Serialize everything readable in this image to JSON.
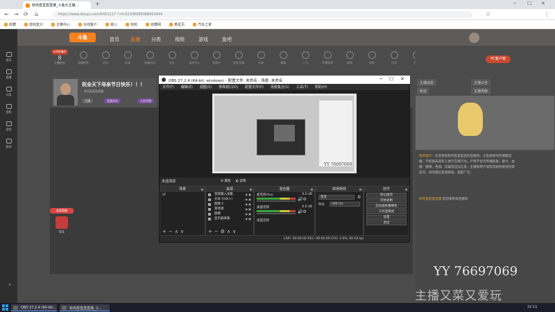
{
  "browser": {
    "tab_title": "秋丙直直直直播_斗鱼大主播...",
    "url": "https://www.douyu.com/6451217 ?=0.62206985988001644",
    "bookmarks": [
      "收藏",
      "游戏盒计",
      "主推中心",
      "在线客户",
      "婴儿",
      "哈哈",
      "收藏网",
      "黄星页",
      "汽车之家"
    ]
  },
  "site": {
    "logo": "斗鱼",
    "nav": [
      "首页",
      "直播",
      "分类",
      "视频",
      "游戏",
      "鱼吧"
    ],
    "level": {
      "badge": "LV8直播间",
      "num": "8",
      "label": "主播粉丝"
    },
    "icons": [
      "直播推荐",
      "任务",
      "家具",
      "直播内容",
      "鱼丸",
      "游戏中心",
      "直播卡",
      "鱼丸竞猜",
      "礼物",
      "弹幕",
      "十万",
      "开播推荐",
      "视频",
      "鱼吧",
      "活动",
      "主播",
      "投票",
      "直播",
      "更多"
    ],
    "pc_button": "PC客户端",
    "room_title": "祝全天下母亲节日快乐！！！",
    "streamer_name": "秋丙直直直直播",
    "pills": [
      "主播",
      "直播游戏",
      "斗鱼直播"
    ],
    "right_tabs": [
      "主播动态",
      "主播公告",
      "粉丝",
      "主播贡献"
    ],
    "chat_system": "系统提示：",
    "chat_body": "欢迎来到秋丙直直直直的直播间。斗鱼倡导绿色健康直播，不提倡未成年人进行充值行为。严禁平台内传播低俗、暴力、血腥、赌博、色情、诈骗等违法信息，主播和用户如有违规将受到封禁处罚。请勿相信各类刷钻、兼职广告。",
    "chat2_name": "秋丙直直直直播",
    "chat2_text": " 欢迎来到本直播间",
    "gift_label": "连续直播",
    "gift_count": "0/1",
    "watermark_yy": "YY 76697069",
    "watermark_cn": "主播又菜又爱玩",
    "left_nav": [
      "首页",
      "直播",
      "分类",
      "视频",
      "游戏",
      "鱼吧"
    ]
  },
  "obs": {
    "title": "OBS 27.2.4 (64-bit, windows) - 配置文件: 未命名 - 场景: 未命名",
    "menu": [
      "文件(F)",
      "编辑(E)",
      "视图(V)",
      "停靠窗口(D)",
      "配置文件(P)",
      "场景集合(S)",
      "工具(T)",
      "帮助(H)"
    ],
    "preview_watermark": "YY 76697069",
    "no_source": "未选择源",
    "props_btn": "属性",
    "filters_btn": "滤镜",
    "docks": {
      "scenes": "场景",
      "sources": "来源",
      "mixer": "混音器",
      "transitions": "转场特效",
      "controls": "控件"
    },
    "scene_list": [
      "cf"
    ],
    "sources": [
      "音频输入采集",
      "文本 (GDI+)",
      "图像 2",
      "游戏源",
      "图像",
      "显示器采集"
    ],
    "mixer": [
      {
        "name": "麦克风/Aux",
        "db": "0.0 dB"
      },
      {
        "name": "桌面音频",
        "db": "0.0 dB"
      }
    ],
    "mixer_extra": "桌面音频",
    "transition": {
      "type": "渐变",
      "duration_label": "时长",
      "duration": "300 ms"
    },
    "controls": [
      "停止推流",
      "开始录制",
      "启动虚拟摄像机",
      "工作室模式",
      "设置",
      "退出"
    ],
    "status": "LIVE: 00:00:00    REC: 00:00:00    CPU: 2.0%, 60.00 fps"
  },
  "taskbar": {
    "items": [
      "OBS 27.2.4 (64-bit...",
      "秋丙直直直直播_斗..."
    ],
    "clock": "22:11"
  }
}
